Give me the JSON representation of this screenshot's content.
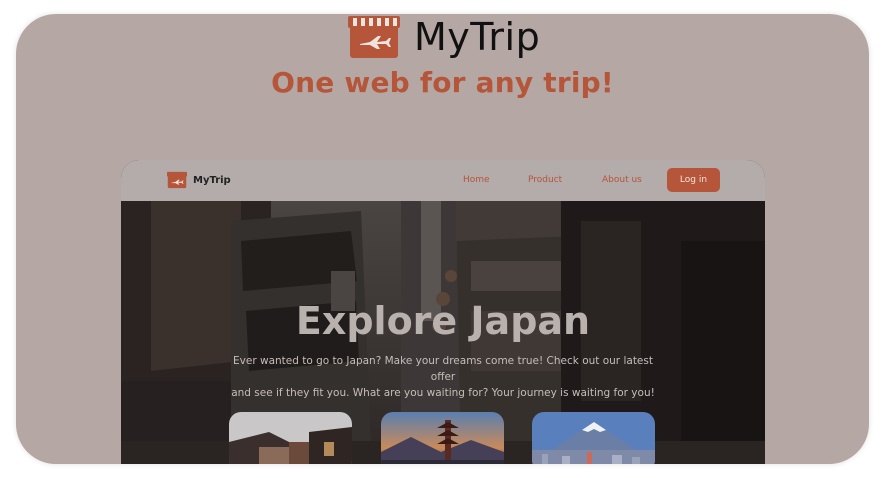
{
  "app": {
    "brand": "MyTrip",
    "tagline": "One web for any trip!"
  },
  "mockup": {
    "nav": {
      "brand": "MyTrip",
      "links": [
        "Home",
        "Product",
        "About us"
      ],
      "login_label": "Log in"
    },
    "hero": {
      "title": "Explore Japan",
      "subtitle_line1": "Ever wanted to go to Japan? Make your dreams come true! Check out our latest offer",
      "subtitle_line2": "and see if they fit you. What are you waiting for? Your journey is waiting for you!"
    },
    "thumbnails": [
      "kyoto-street-photo",
      "pagoda-sunset-photo",
      "mount-fuji-city-photo"
    ]
  },
  "colors": {
    "accent": "#b5553a",
    "card_background": "#b5a7a3",
    "mock_nav_background": "#b3acaa"
  },
  "icons": {
    "logo": "storefront-airplane-icon"
  }
}
